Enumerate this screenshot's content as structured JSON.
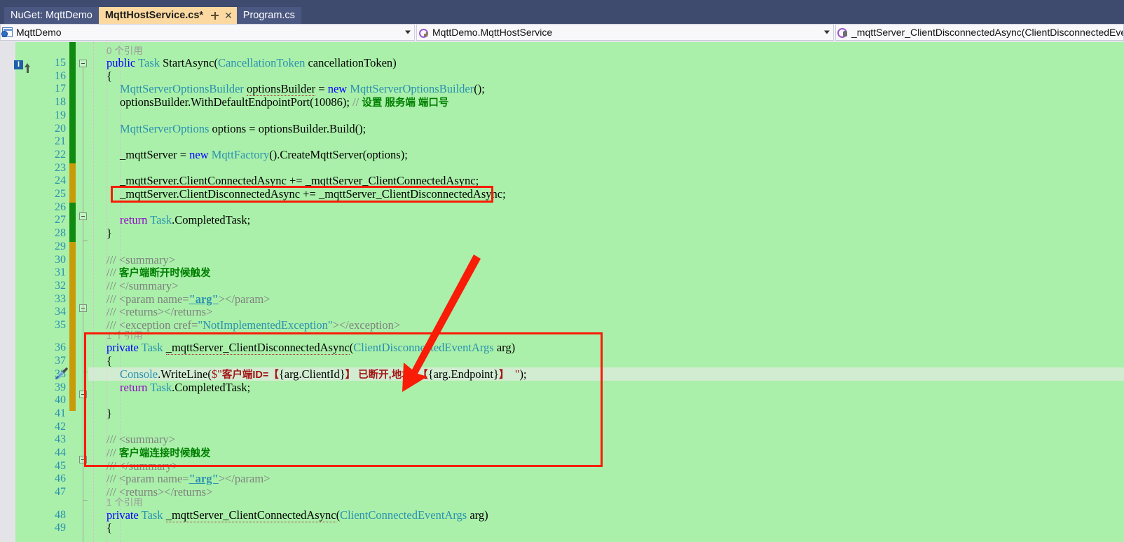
{
  "window": {
    "app": "Visual Studio",
    "accent_color": "#3f4b6e",
    "active_tab_color": "#fcd9a0",
    "annotation_color": "#f91c06",
    "editor_background": "#aaf0aa"
  },
  "tabs": [
    {
      "label": "NuGet: MqttDemo",
      "active": false,
      "modified": false
    },
    {
      "label": "MqttHostService.cs*",
      "active": true,
      "modified": true
    },
    {
      "label": "Program.cs",
      "active": false,
      "modified": false
    }
  ],
  "navbar": {
    "project": {
      "label": "MqttDemo",
      "icon": "project-globe-icon"
    },
    "type": {
      "label": "MqttDemo.MqttHostService",
      "icon": "class-icon"
    },
    "member": {
      "label": "_mqttServer_ClientDisconnectedAsync(ClientDisconnectedEventA",
      "icon": "private-method-icon"
    }
  },
  "editor": {
    "first_visible_line": 14,
    "current_line": 38,
    "line_height": 18.7,
    "lines": [
      {
        "n": 15
      },
      {
        "n": 16
      },
      {
        "n": 17
      },
      {
        "n": 18
      },
      {
        "n": 19
      },
      {
        "n": 20
      },
      {
        "n": 21
      },
      {
        "n": 22
      },
      {
        "n": 23
      },
      {
        "n": 24
      },
      {
        "n": 25
      },
      {
        "n": 26
      },
      {
        "n": 27
      },
      {
        "n": 28
      },
      {
        "n": 29
      },
      {
        "n": 30
      },
      {
        "n": 31
      },
      {
        "n": 32
      },
      {
        "n": 33
      },
      {
        "n": 34
      },
      {
        "n": 35
      },
      {
        "n": 36
      },
      {
        "n": 37
      },
      {
        "n": 38
      },
      {
        "n": 39
      },
      {
        "n": 40
      },
      {
        "n": 41
      },
      {
        "n": 42
      },
      {
        "n": 43
      },
      {
        "n": 44
      },
      {
        "n": 45
      },
      {
        "n": 46
      },
      {
        "n": 47
      },
      {
        "n": 48
      },
      {
        "n": 49
      }
    ],
    "codelens": {
      "start_async": "0 个引用",
      "disconnected_async": "1 个引用",
      "connected_async": "1 个引用"
    },
    "code": {
      "l15": "public Task StartAsync(CancellationToken cancellationToken)",
      "l16": "{",
      "l17": "MqttServerOptionsBuilder optionsBuilder = new MqttServerOptionsBuilder();",
      "l18": "optionsBuilder.WithDefaultEndpointPort(10086); // 设置 服务端 端口号",
      "l18_comment": "// 设置 服务端 端口号",
      "l18_port": "10086",
      "l20": "MqttServerOptions options = optionsBuilder.Build();",
      "l22": "_mqttServer = new MqttFactory().CreateMqttServer(options);",
      "l24": "_mqttServer.ClientConnectedAsync += _mqttServer_ClientConnectedAsync;",
      "l25": "_mqttServer.ClientDisconnectedAsync += _mqttServer_ClientDisconnectedAsync;",
      "l27": "return Task.CompletedTask;",
      "l28": "}",
      "l30": "/// <summary>",
      "l31_doc": "/// 客户端断开时候触发",
      "l31_text": "客户端断开时候触发",
      "l32": "/// </summary>",
      "l33": "/// <param name=\"arg\"></param>",
      "l34": "/// <returns></returns>",
      "l35": "/// <exception cref=\"NotImplementedException\"></exception>",
      "l36": "private Task _mqttServer_ClientDisconnectedAsync(ClientDisconnectedEventArgs arg)",
      "l37": "{",
      "l38": "Console.WriteLine($\"客户端ID=【{arg.ClientId}】已断开,地址=【{arg.Endpoint}】  \");",
      "l38_prefix": "客户端ID=",
      "l38_mid": "已断开,地址=",
      "l39": "return Task.CompletedTask;",
      "l41": "}",
      "l43": "/// <summary>",
      "l44_doc": "/// 客户端连接时候触发",
      "l44_text": "客户端连接时候触发",
      "l45": "/// </summary>",
      "l46": "/// <param name=\"arg\"></param>",
      "l47": "/// <returns></returns>",
      "l48": "private Task _mqttServer_ClientConnectedAsync(ClientConnectedEventArgs arg)",
      "l49": "{"
    },
    "glyphs": {
      "line15_indicator": "I",
      "line38_quick_actions": "screwdriver-icon"
    }
  },
  "annotations": {
    "box_top_label": "highlight on _mqttServer.ClientDisconnectedAsync subscription",
    "box_bottom_label": "highlight on _mqttServer_ClientDisconnectedAsync method body",
    "arrow_label": "arrow from subscription line to handler method"
  }
}
